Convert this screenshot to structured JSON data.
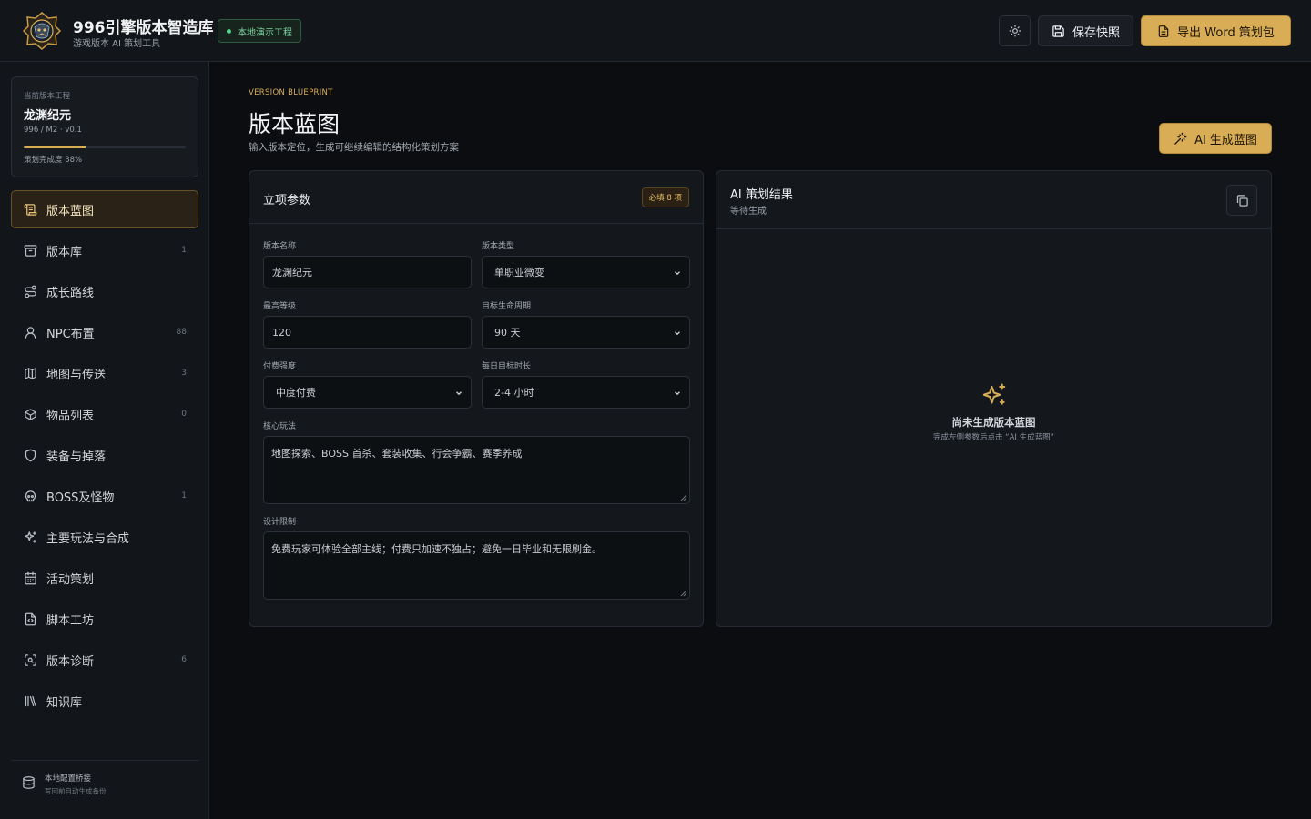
{
  "app": {
    "title": "996引擎版本智造库",
    "subtitle": "游戏版本 AI 策划工具",
    "env_badge": "本地演示工程"
  },
  "toolbar": {
    "theme_icon": "sun-icon",
    "save_label": "保存快照",
    "export_label": "导出 Word 策划包"
  },
  "project": {
    "label": "当前版本工程",
    "name": "龙渊纪元",
    "meta": "996 / M2 · v0.1",
    "progress_text": "策划完成度 38%",
    "progress": 0.38
  },
  "sidebar": {
    "items": [
      {
        "label": "版本蓝图",
        "icon": "blueprint-icon",
        "count": "",
        "active": true
      },
      {
        "label": "版本库",
        "icon": "archive-icon",
        "count": "1"
      },
      {
        "label": "成长路线",
        "icon": "route-icon",
        "count": ""
      },
      {
        "label": "NPC布置",
        "icon": "user-icon",
        "count": "88"
      },
      {
        "label": "地图与传送",
        "icon": "map-icon",
        "count": "3"
      },
      {
        "label": "物品列表",
        "icon": "package-icon",
        "count": "0"
      },
      {
        "label": "装备与掉落",
        "icon": "shield-icon",
        "count": ""
      },
      {
        "label": "BOSS及怪物",
        "icon": "skull-icon",
        "count": "1"
      },
      {
        "label": "主要玩法与合成",
        "icon": "sparkles-icon",
        "count": ""
      },
      {
        "label": "活动策划",
        "icon": "calendar-icon",
        "count": ""
      },
      {
        "label": "脚本工坊",
        "icon": "script-icon",
        "count": ""
      },
      {
        "label": "版本诊断",
        "icon": "scan-icon",
        "count": "6"
      },
      {
        "label": "知识库",
        "icon": "library-icon",
        "count": ""
      }
    ],
    "footer_title": "本地配置桥接",
    "footer_sub": "写回前自动生成备份"
  },
  "page": {
    "eyebrow": "VERSION BLUEPRINT",
    "title": "版本蓝图",
    "subtitle": "输入版本定位，生成可继续编辑的结构化策划方案",
    "generate_label": "AI 生成蓝图"
  },
  "form": {
    "title": "立项参数",
    "required_badge": "必填 8 项",
    "version_name": {
      "label": "版本名称",
      "value": "龙渊纪元"
    },
    "version_type": {
      "label": "版本类型",
      "value": "单职业微变"
    },
    "max_level": {
      "label": "最高等级",
      "value": "120"
    },
    "lifecycle": {
      "label": "目标生命周期",
      "value": "90 天"
    },
    "pay_level": {
      "label": "付费强度",
      "value": "中度付费"
    },
    "daily_time": {
      "label": "每日目标时长",
      "value": "2-4 小时"
    },
    "core_gameplay": {
      "label": "核心玩法",
      "value": "地图探索、BOSS 首杀、套装收集、行会争霸、赛季养成"
    },
    "constraints": {
      "label": "设计限制",
      "value": "免费玩家可体验全部主线；付费只加速不独占；避免一日毕业和无限刷金。"
    }
  },
  "result": {
    "title": "AI 策划结果",
    "status": "等待生成",
    "empty_title": "尚未生成版本蓝图",
    "empty_sub": "完成左侧参数后点击 “AI 生成蓝图”"
  },
  "colors": {
    "accent": "#d8ad55",
    "background": "#0b0d10",
    "panel": "#14181d",
    "success": "#4fd08a"
  }
}
